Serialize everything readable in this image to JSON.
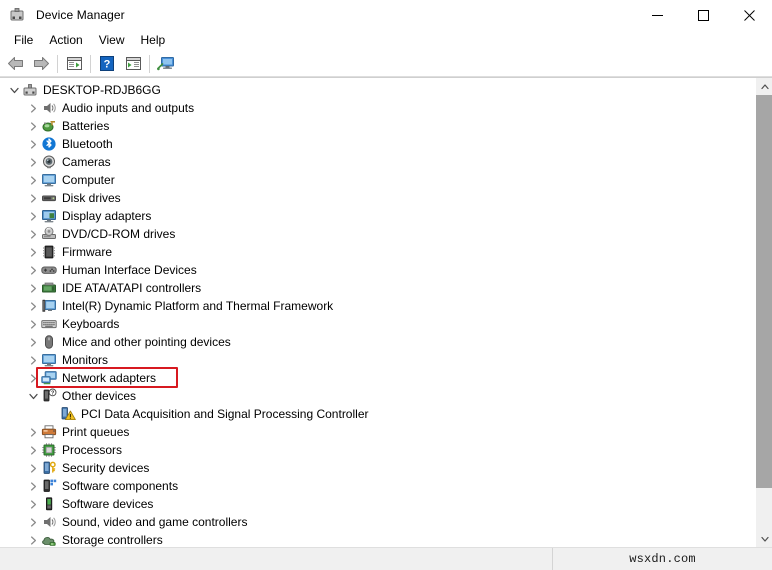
{
  "window": {
    "title": "Device Manager",
    "icon": "device-manager-icon",
    "controls": {
      "minimize": "minimize-icon",
      "maximize": "maximize-icon",
      "close": "close-icon"
    }
  },
  "menubar": {
    "items": [
      {
        "label": "File"
      },
      {
        "label": "Action"
      },
      {
        "label": "View"
      },
      {
        "label": "Help"
      }
    ]
  },
  "toolbar": {
    "buttons": [
      {
        "name": "back-button",
        "icon": "back-arrow-icon"
      },
      {
        "name": "forward-button",
        "icon": "forward-arrow-icon"
      },
      {
        "name": "separator-1",
        "icon": "separator"
      },
      {
        "name": "properties-button",
        "icon": "properties-icon"
      },
      {
        "name": "separator-2",
        "icon": "separator"
      },
      {
        "name": "help-button",
        "icon": "help-question-icon"
      },
      {
        "name": "update-driver-button",
        "icon": "update-driver-icon"
      },
      {
        "name": "separator-3",
        "icon": "separator"
      },
      {
        "name": "scan-hardware-button",
        "icon": "scan-hardware-icon"
      }
    ]
  },
  "tree": {
    "root": {
      "label": "DESKTOP-RDJB6GG",
      "icon": "computer-root-icon",
      "expanded": true,
      "indent": 0
    },
    "items": [
      {
        "label": "Audio inputs and outputs",
        "icon": "speaker-icon",
        "expanded": false,
        "indent": 1,
        "highlighted": false
      },
      {
        "label": "Batteries",
        "icon": "battery-icon",
        "expanded": false,
        "indent": 1,
        "highlighted": false
      },
      {
        "label": "Bluetooth",
        "icon": "bluetooth-icon",
        "expanded": false,
        "indent": 1,
        "highlighted": false
      },
      {
        "label": "Cameras",
        "icon": "camera-icon",
        "expanded": false,
        "indent": 1,
        "highlighted": false
      },
      {
        "label": "Computer",
        "icon": "monitor-icon",
        "expanded": false,
        "indent": 1,
        "highlighted": false
      },
      {
        "label": "Disk drives",
        "icon": "disk-drive-icon",
        "expanded": false,
        "indent": 1,
        "highlighted": false
      },
      {
        "label": "Display adapters",
        "icon": "display-adapter-icon",
        "expanded": false,
        "indent": 1,
        "highlighted": false
      },
      {
        "label": "DVD/CD-ROM drives",
        "icon": "optical-drive-icon",
        "expanded": false,
        "indent": 1,
        "highlighted": false
      },
      {
        "label": "Firmware",
        "icon": "firmware-chip-icon",
        "expanded": false,
        "indent": 1,
        "highlighted": false
      },
      {
        "label": "Human Interface Devices",
        "icon": "hid-gamepad-icon",
        "expanded": false,
        "indent": 1,
        "highlighted": false
      },
      {
        "label": "IDE ATA/ATAPI controllers",
        "icon": "ide-controller-icon",
        "expanded": false,
        "indent": 1,
        "highlighted": false
      },
      {
        "label": "Intel(R) Dynamic Platform and Thermal Framework",
        "icon": "thermal-framework-icon",
        "expanded": false,
        "indent": 1,
        "highlighted": false
      },
      {
        "label": "Keyboards",
        "icon": "keyboard-icon",
        "expanded": false,
        "indent": 1,
        "highlighted": false
      },
      {
        "label": "Mice and other pointing devices",
        "icon": "mouse-icon",
        "expanded": false,
        "indent": 1,
        "highlighted": false
      },
      {
        "label": "Monitors",
        "icon": "monitor-icon",
        "expanded": false,
        "indent": 1,
        "highlighted": false
      },
      {
        "label": "Network adapters",
        "icon": "network-adapter-icon",
        "expanded": false,
        "indent": 1,
        "highlighted": true
      },
      {
        "label": "Other devices",
        "icon": "other-devices-icon",
        "expanded": true,
        "indent": 1,
        "highlighted": false
      },
      {
        "label": "PCI Data Acquisition and Signal Processing Controller",
        "icon": "unknown-device-warning-icon",
        "expanded": null,
        "indent": 2,
        "highlighted": false
      },
      {
        "label": "Print queues",
        "icon": "printer-icon",
        "expanded": false,
        "indent": 1,
        "highlighted": false
      },
      {
        "label": "Processors",
        "icon": "processor-icon",
        "expanded": false,
        "indent": 1,
        "highlighted": false
      },
      {
        "label": "Security devices",
        "icon": "security-device-icon",
        "expanded": false,
        "indent": 1,
        "highlighted": false
      },
      {
        "label": "Software components",
        "icon": "software-component-icon",
        "expanded": false,
        "indent": 1,
        "highlighted": false
      },
      {
        "label": "Software devices",
        "icon": "software-device-icon",
        "expanded": false,
        "indent": 1,
        "highlighted": false
      },
      {
        "label": "Sound, video and game controllers",
        "icon": "speaker-icon",
        "expanded": false,
        "indent": 1,
        "highlighted": false
      },
      {
        "label": "Storage controllers",
        "icon": "storage-controller-icon",
        "expanded": false,
        "indent": 1,
        "highlighted": false
      }
    ]
  },
  "highlight": {
    "color": "#d71920",
    "target": "Network adapters"
  },
  "scrollbar": {
    "up": "scroll-up-arrow-icon",
    "down": "scroll-down-arrow-icon",
    "thumb_position": "top"
  },
  "statusbar": {
    "left_text": "",
    "watermark": "wsxdn.com"
  }
}
